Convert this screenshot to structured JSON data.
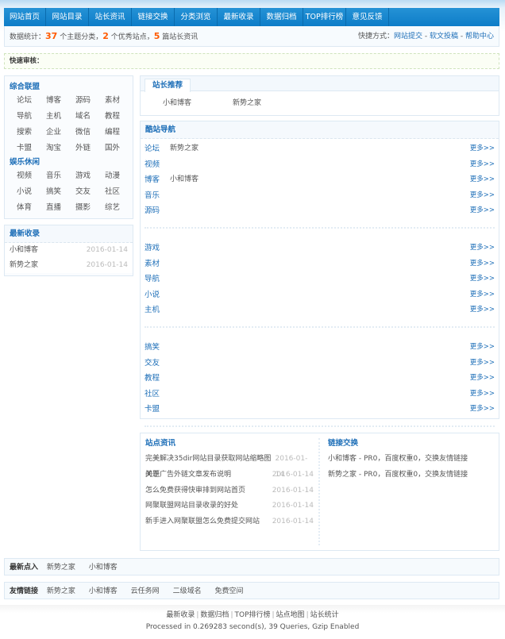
{
  "nav": {
    "items": [
      "网站首页",
      "网站目录",
      "站长资讯",
      "链接交换",
      "分类浏览",
      "最新收录",
      "数据归档",
      "TOP排行榜",
      "意见反馈"
    ]
  },
  "stats": {
    "prefix": "数据统计：",
    "categories_count": "37",
    "categories_label": " 个主题分类，",
    "sites_count": "2",
    "sites_label": " 个优秀站点，",
    "articles_count": "5",
    "articles_label": " 篇站长资讯",
    "shortcut_label": "快捷方式：",
    "shortcuts": [
      "网站提交",
      "软文投稿",
      "帮助中心"
    ],
    "shortcut_sep": " - "
  },
  "quick_audit": {
    "label": "快速审核："
  },
  "categories": {
    "group1_title": "综合联盟",
    "group1": [
      "论坛",
      "博客",
      "源码",
      "素材",
      "导航",
      "主机",
      "域名",
      "教程",
      "搜索",
      "企业",
      "微信",
      "编程",
      "卡盟",
      "淘宝",
      "外链",
      "国外"
    ],
    "group2_title": "娱乐休闲",
    "group2": [
      "视频",
      "音乐",
      "游戏",
      "动漫",
      "小说",
      "搞笑",
      "交友",
      "社区",
      "体育",
      "直播",
      "摄影",
      "综艺"
    ]
  },
  "latest": {
    "title": "最新收录",
    "items": [
      {
        "name": "小和博客",
        "date": "2016-01-14"
      },
      {
        "name": "新势之家",
        "date": "2016-01-14"
      }
    ]
  },
  "recommend": {
    "tab": "站长推荐",
    "items": [
      "小和博客",
      "新势之家"
    ]
  },
  "coolnav": {
    "title": "酷站导航",
    "more": "更多>>",
    "groups": [
      [
        {
          "cat": "论坛",
          "site": "新势之家"
        },
        {
          "cat": "视频",
          "site": ""
        },
        {
          "cat": "博客",
          "site": "小和博客"
        },
        {
          "cat": "音乐",
          "site": ""
        },
        {
          "cat": "源码",
          "site": ""
        }
      ],
      [
        {
          "cat": "游戏",
          "site": ""
        },
        {
          "cat": "素材",
          "site": ""
        },
        {
          "cat": "导航",
          "site": ""
        },
        {
          "cat": "小说",
          "site": ""
        },
        {
          "cat": "主机",
          "site": ""
        }
      ],
      [
        {
          "cat": "搞笑",
          "site": ""
        },
        {
          "cat": "交友",
          "site": ""
        },
        {
          "cat": "教程",
          "site": ""
        },
        {
          "cat": "社区",
          "site": ""
        },
        {
          "cat": "卡盟",
          "site": ""
        }
      ]
    ]
  },
  "news": {
    "title": "站点资讯",
    "items": [
      {
        "title": "完美解决35dir网站目录获取网站缩略图问题",
        "date": "2016-01-14"
      },
      {
        "title": "关于广告外链文章发布说明",
        "date": "2016-01-14"
      },
      {
        "title": "怎么免费获得快审排到网站首页",
        "date": "2016-01-14"
      },
      {
        "title": "网聚联盟网站目录收录的好处",
        "date": "2016-01-14"
      },
      {
        "title": "新手进入网聚联盟怎么免费提交网站",
        "date": "2016-01-14"
      }
    ]
  },
  "exchange": {
    "title": "链接交换",
    "items": [
      "小和博客 - PR0，百度权重0，交换友情链接",
      "新势之家 - PR0，百度权重0，交换友情链接"
    ]
  },
  "newin": {
    "label": "最新点入",
    "items": [
      "新势之家",
      "小和博客"
    ]
  },
  "friends": {
    "label": "友情链接",
    "items": [
      "新势之家",
      "小和博客",
      "云任务网",
      "二级域名",
      "免费空间"
    ]
  },
  "footer": {
    "links": [
      "最新收录",
      "数据归档",
      "TOP排行榜",
      "站点地图",
      "站长统计"
    ],
    "processed": "Processed in 0.269283 second(s), 39 Queries, Gzip Enabled"
  }
}
